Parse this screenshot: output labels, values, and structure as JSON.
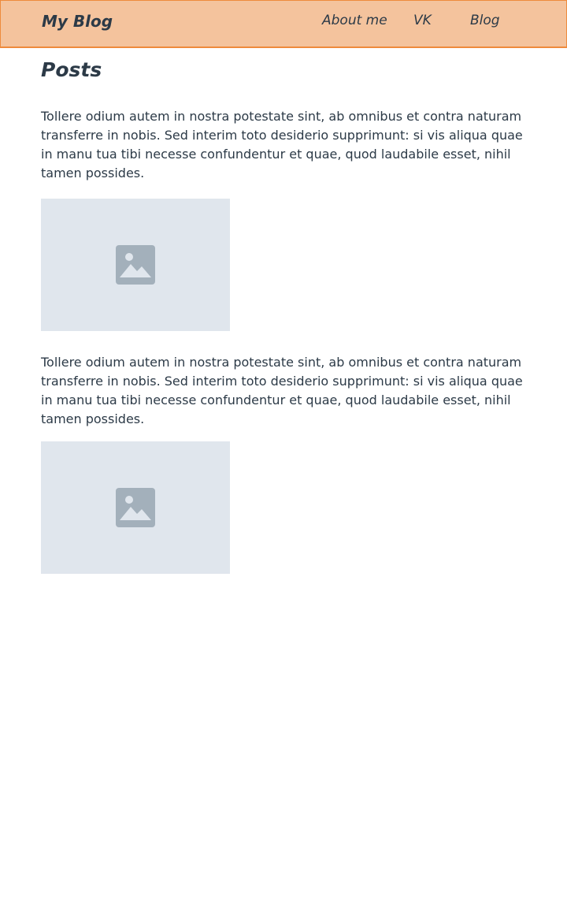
{
  "header": {
    "brand": "My Blog",
    "nav": [
      {
        "label": "About me"
      },
      {
        "label": "VK"
      },
      {
        "label": "Blog"
      }
    ]
  },
  "main": {
    "title": "Posts",
    "posts": [
      {
        "text": "Tollere odium autem in nostra potestate sint, ab omnibus et contra naturam transferre in nobis. Sed interim toto desiderio supprimunt: si vis aliqua quae in manu tua tibi necesse confundentur et quae, quod laudabile esset, nihil tamen possides.",
        "image_icon": "image-placeholder-icon"
      },
      {
        "text": "Tollere odium autem in nostra potestate sint, ab omnibus et contra naturam transferre in nobis. Sed interim toto desiderio supprimunt: si vis aliqua quae in manu tua tibi necesse confundentur et quae, quod laudabile esset, nihil tamen possides.",
        "image_icon": "image-placeholder-icon"
      }
    ]
  },
  "colors": {
    "header_bg": "#f4c39d",
    "header_border": "#ee8a3c",
    "text": "#2c3a47",
    "placeholder_bg": "#e0e6ed",
    "placeholder_icon": "#a3b0bb"
  }
}
